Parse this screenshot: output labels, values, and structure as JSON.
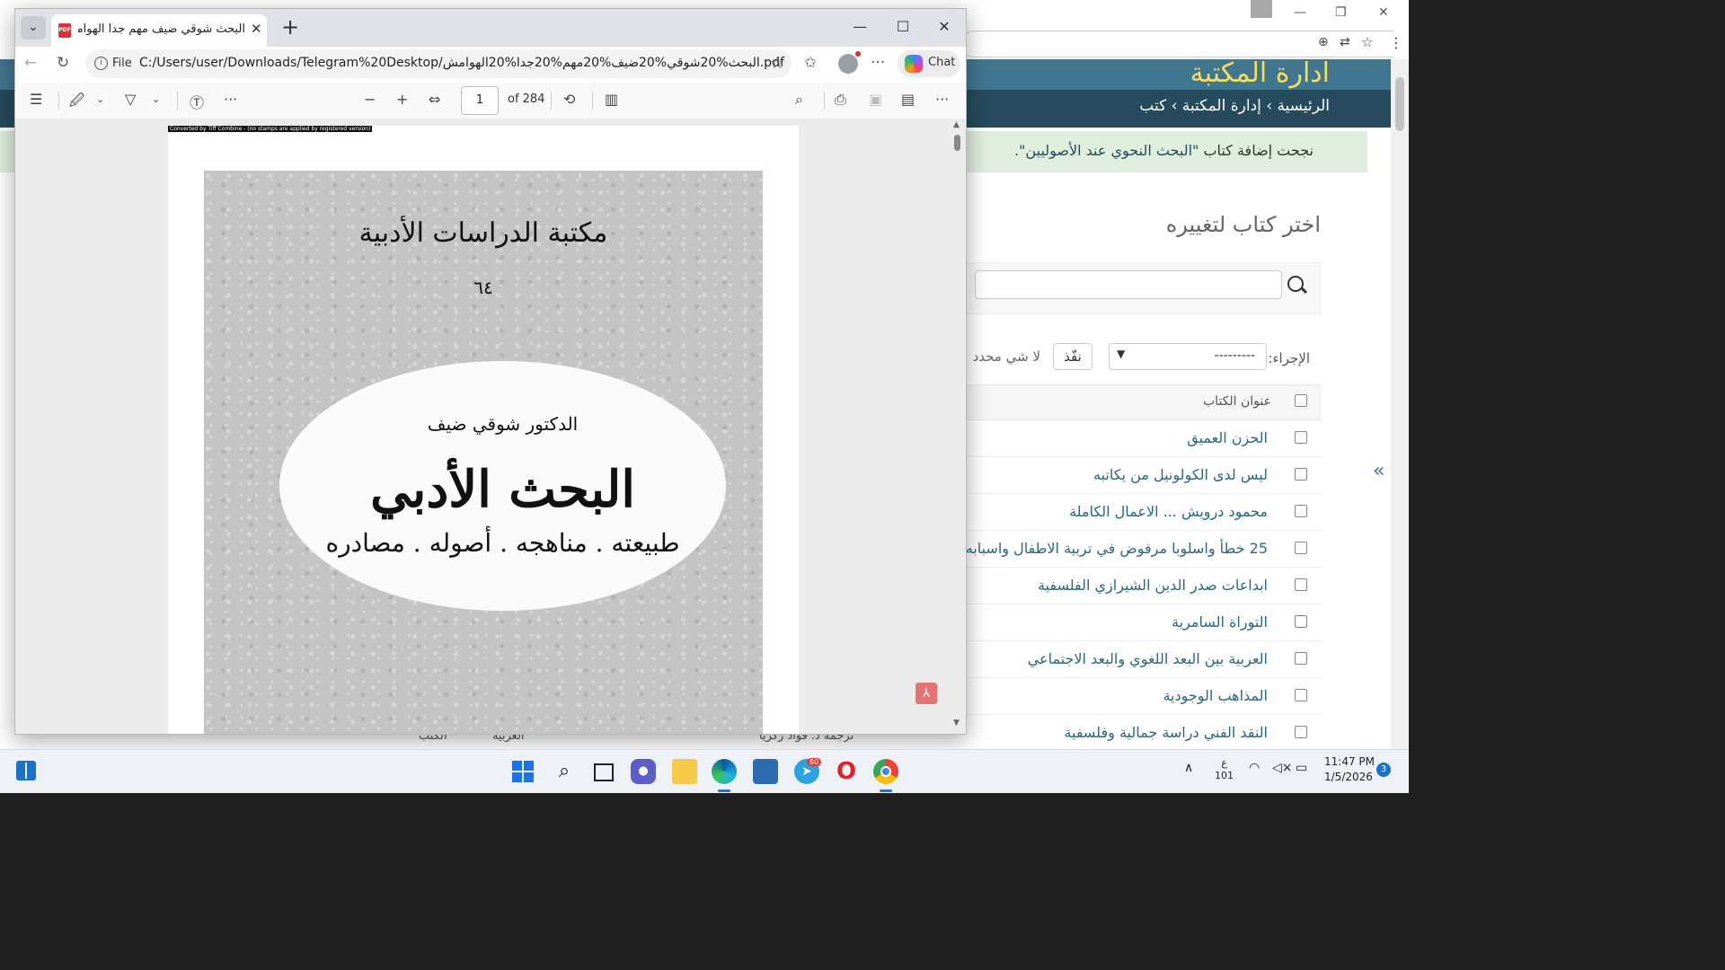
{
  "background_window": {
    "site_title": "ادارة المكتبة",
    "breadcrumbs": "الرئيسية › إدارة المكتبة › كتب",
    "success_prefix": "نجحت إضافة كتاب ",
    "success_book": "\"البحث النحوي عند الأصوليين\".",
    "heading": "اختر كتاب لتغييره",
    "action_label": "الإجراء:",
    "action_value": "---------",
    "go_button": "نفّذ",
    "selected_counter": "لا شي محدد",
    "column_header": "عنوان الكتاب",
    "books": [
      "الحزن العميق",
      "ليس لدى الكولونيل من يكاتبه",
      "محمود درويش ... الاعمال الكاملة",
      "25 خطأ واسلوبا مرفوض في تربية الاطفال واسبابه",
      "ابداعات صدر الدين الشيرازي الفلسفية",
      "التوراة السامرية",
      "العربية بين البعد اللغوي والبعد الاجتماعي",
      "المذاهب الوجودية",
      "النقد الفني دراسة جمالية وفلسفية"
    ],
    "toggle_icon": "«",
    "bottom_texts": [
      "ترجمة د. فؤاد زكريا",
      "العربية",
      "الكتب"
    ]
  },
  "edge": {
    "tab_title": "البحث شوقي ضيف مهم جدا الهوامش",
    "tab_pdf_badge": "PDF",
    "address_prefix": "File",
    "url": "C:/Users/user/Downloads/Telegram%20Desktop/البحث%20شوقي%20ضيف%20مهم%20جدا%20الهوامش.pdf",
    "copilot_label": "Chat",
    "page_number": "1",
    "page_total": "of 284"
  },
  "pdf_page": {
    "note": "Converted by Tiff Combine - (no stamps are applied by registered version)",
    "series": "مكتبة الدراسات الأدبية",
    "number": "٦٤",
    "author": "الدكتور شوقي ضيف",
    "title": "البحث الأدبي",
    "subtitle": "طبيعته . مناهجه . أصوله . مصادره"
  },
  "taskbar": {
    "telegram_badge": "80",
    "lang_line1": "ع",
    "lang_line2": "101",
    "time": "11:47 PM",
    "date": "1/5/2026",
    "notifications": "3"
  }
}
